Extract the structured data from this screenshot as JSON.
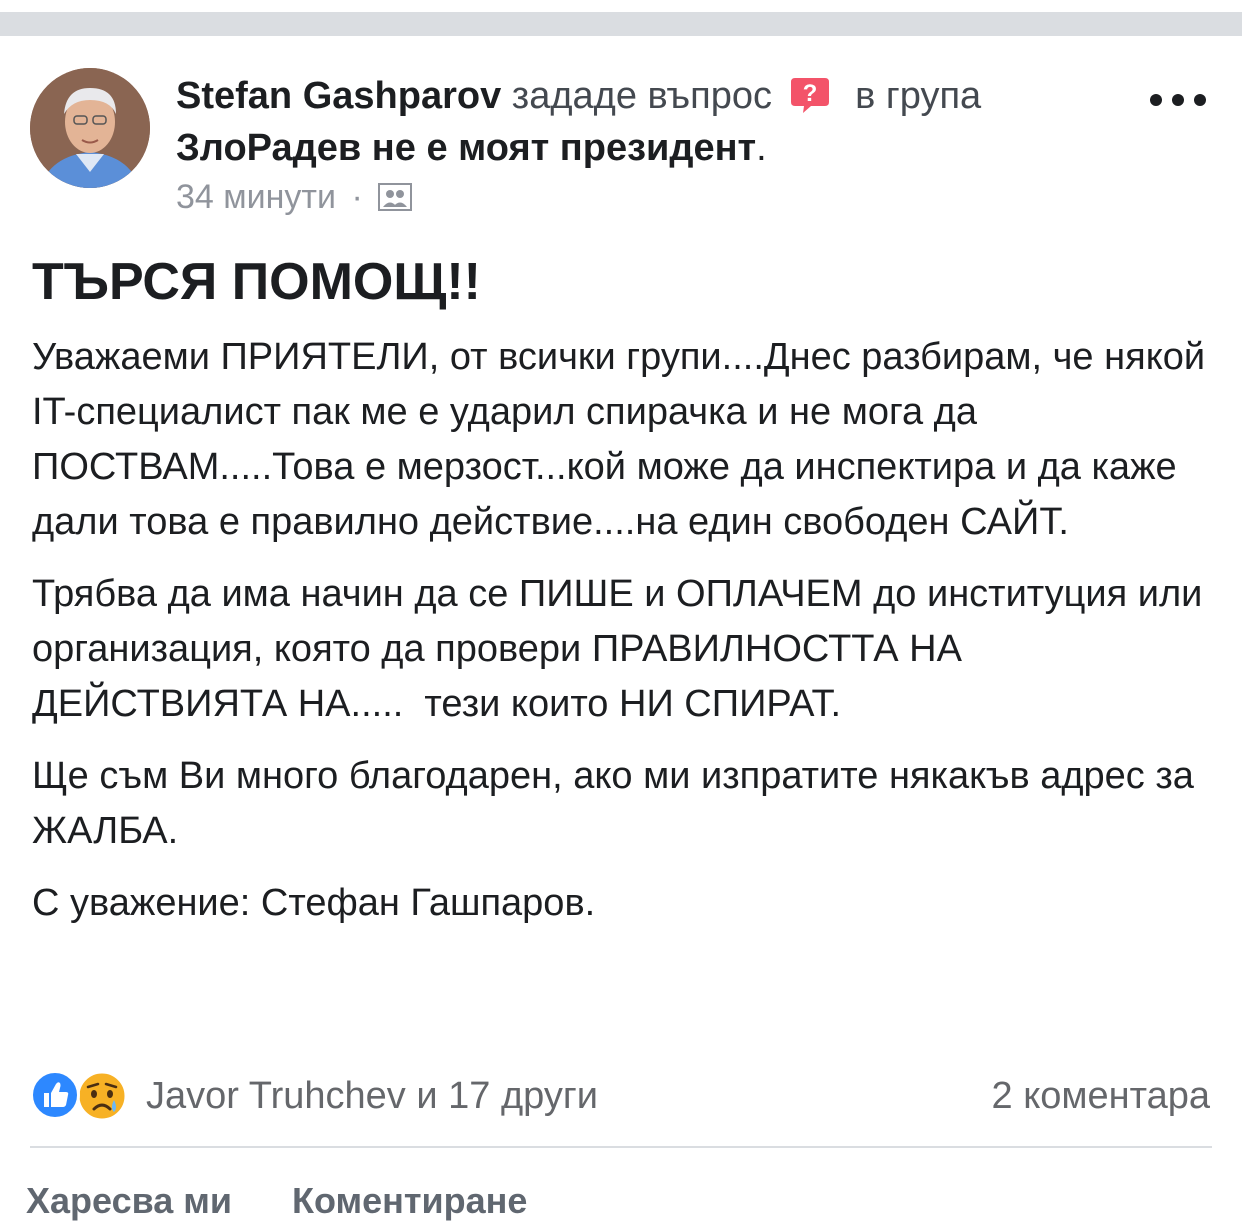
{
  "post": {
    "author": "Stefan Gashparov",
    "action_text": "зададе въпрос",
    "question_icon": "question-mark-badge-icon",
    "in_group_text": "в група",
    "group_name": "ЗлоРадев не е моят президент",
    "group_suffix": ".",
    "timestamp": "34 минути",
    "meta_separator": "·",
    "privacy_icon": "group-members-icon",
    "title": "ТЪРСЯ ПОМОЩ!!",
    "paragraphs": [
      "Уважаеми ПРИЯТЕЛИ, от всички групи....Днес разбирам, че някой IT-специалист пак ме е ударил спирачка и не мога да ПОСТВАМ.....Това е мерзост...кой може да инспектира и да каже дали това е правилно действие....на един свободен САЙТ.",
      "Трябва да има начин да се ПИШЕ и ОПЛАЧЕМ до институция или организация, която да провери ПРАВИЛНОСТТА НА ДЕЙСТВИЯТА НА.....  тези които НИ СПИРАТ.",
      "Ще съм Ви много благодарен, ако ми изпратите някакъв адрес за ЖАЛБА.",
      "С уважение: Стефан Гашпаров."
    ]
  },
  "reactions": {
    "icons": [
      "like-icon",
      "sad-icon"
    ],
    "reactors_text": "Javor Truhchev и 17 други",
    "comments_text": "2 коментара"
  },
  "actions": {
    "like_label": "Харесва ми",
    "comment_label": "Коментиране"
  },
  "colors": {
    "like_blue": "#2d88ff",
    "question_pink": "#f35369",
    "secondary_text": "#65676b",
    "meta_text": "#90949c"
  }
}
